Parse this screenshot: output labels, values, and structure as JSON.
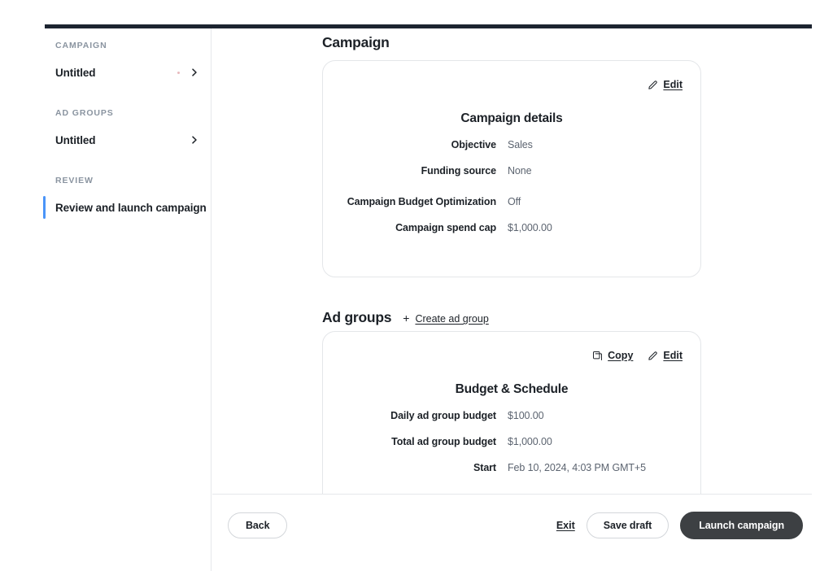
{
  "sidebar": {
    "groups": [
      {
        "kicker": "CAMPAIGN",
        "items": [
          {
            "label": "Untitled",
            "has_dot": true,
            "has_chevron": true,
            "active": false
          }
        ]
      },
      {
        "kicker": "AD GROUPS",
        "items": [
          {
            "label": "Untitled",
            "has_dot": false,
            "has_chevron": true,
            "active": false
          }
        ]
      },
      {
        "kicker": "REVIEW",
        "items": [
          {
            "label": "Review and launch campaign",
            "has_dot": false,
            "has_chevron": false,
            "active": true
          }
        ]
      }
    ],
    "accent_color": "#4a94f8"
  },
  "main": {
    "campaign_heading": "Campaign",
    "campaign_card": {
      "edit_label": "Edit",
      "title": "Campaign details",
      "rows": [
        {
          "key": "Objective",
          "value": "Sales"
        },
        {
          "key": "Funding source",
          "value": "None"
        },
        {
          "key": "Campaign Budget Optimization",
          "value": "Off"
        },
        {
          "key": "Campaign spend cap",
          "value": "$1,000.00"
        }
      ]
    },
    "adgroups_heading": "Ad groups",
    "create_ad_group_label": "Create ad group",
    "create_ad_group_plus": "+",
    "adgroup_card": {
      "copy_label": "Copy",
      "edit_label": "Edit",
      "title": "Budget & Schedule",
      "rows": [
        {
          "key": "Daily ad group budget",
          "value": "$100.00"
        },
        {
          "key": "Total ad group budget",
          "value": "$1,000.00"
        },
        {
          "key": "Start",
          "value": "Feb 10, 2024, 4:03 PM GMT+5"
        }
      ]
    }
  },
  "footer": {
    "back_label": "Back",
    "exit_label": "Exit",
    "save_draft_label": "Save draft",
    "launch_label": "Launch campaign",
    "launch_color": "#3d4043"
  }
}
